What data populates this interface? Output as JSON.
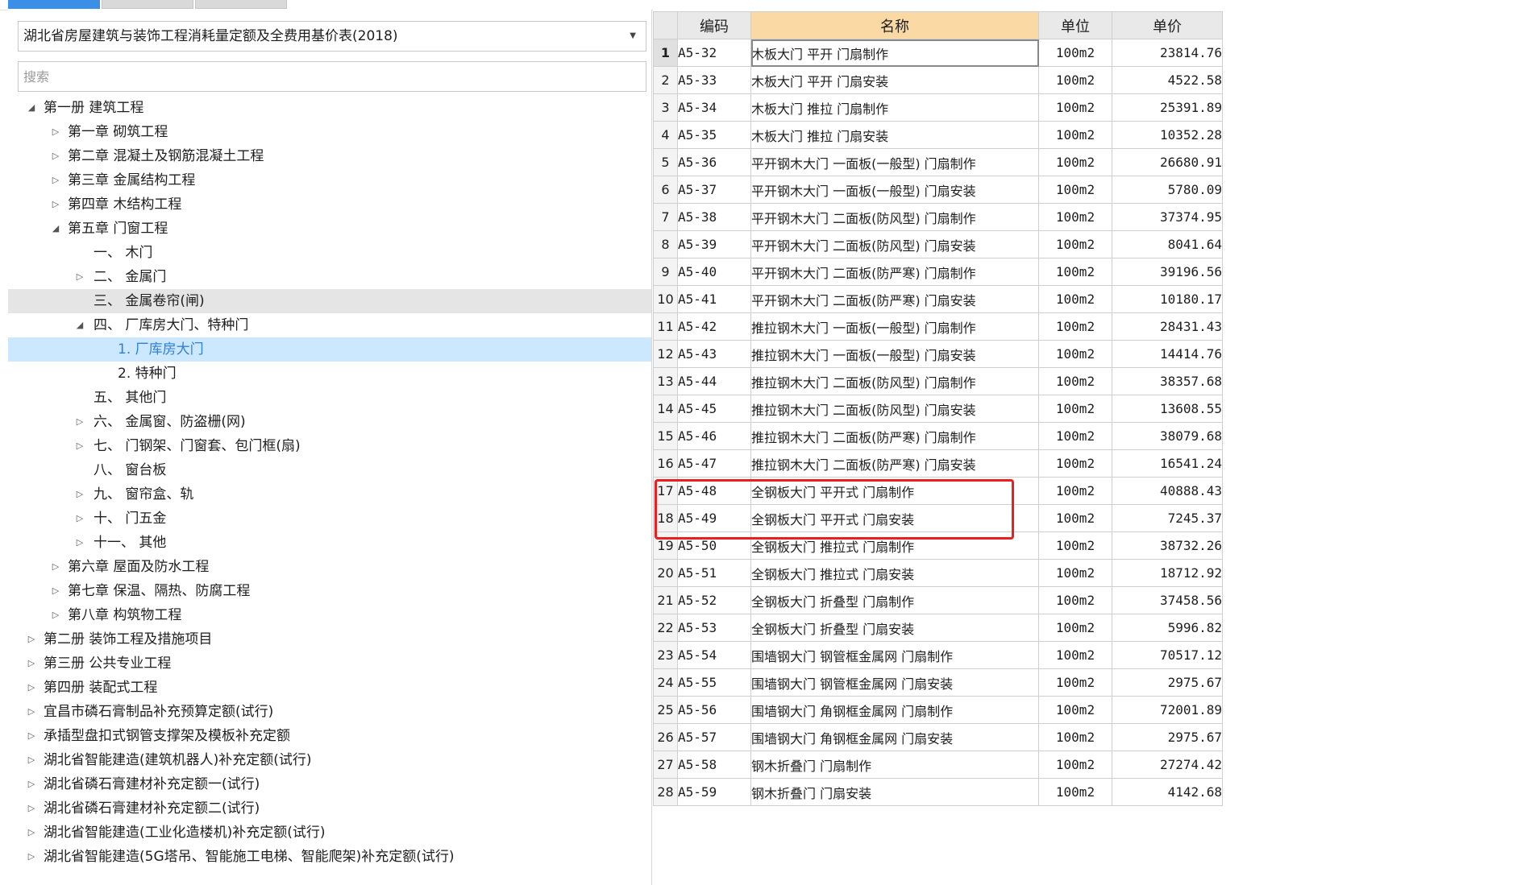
{
  "library": {
    "selected": "湖北省房屋建筑与装饰工程消耗量定额及全费用基价表(2018)"
  },
  "search": {
    "placeholder": "搜索"
  },
  "tree": [
    {
      "label": "第一册 建筑工程",
      "expander": "expanded"
    },
    {
      "label": "第一章 砌筑工程",
      "expander": "collapsed"
    },
    {
      "label": "第二章 混凝土及钢筋混凝土工程",
      "expander": "collapsed"
    },
    {
      "label": "第三章 金属结构工程",
      "expander": "collapsed"
    },
    {
      "label": "第四章 木结构工程",
      "expander": "collapsed"
    },
    {
      "label": "第五章 门窗工程",
      "expander": "expanded"
    },
    {
      "label": "一、 木门",
      "expander": "none"
    },
    {
      "label": "二、 金属门",
      "expander": "collapsed"
    },
    {
      "label": "三、 金属卷帘(闸)",
      "expander": "none",
      "state": "highlight"
    },
    {
      "label": "四、 厂库房大门、特种门",
      "expander": "expanded"
    },
    {
      "label": "1. 厂库房大门",
      "expander": "none",
      "state": "selected"
    },
    {
      "label": "2. 特种门",
      "expander": "none"
    },
    {
      "label": "五、 其他门",
      "expander": "none"
    },
    {
      "label": "六、 金属窗、防盗栅(网)",
      "expander": "collapsed"
    },
    {
      "label": "七、 门钢架、门窗套、包门框(扇)",
      "expander": "collapsed"
    },
    {
      "label": "八、 窗台板",
      "expander": "none"
    },
    {
      "label": "九、 窗帘盒、轨",
      "expander": "collapsed"
    },
    {
      "label": "十、 门五金",
      "expander": "collapsed"
    },
    {
      "label": "十一、 其他",
      "expander": "collapsed"
    },
    {
      "label": "第六章 屋面及防水工程",
      "expander": "collapsed"
    },
    {
      "label": "第七章 保温、隔热、防腐工程",
      "expander": "collapsed"
    },
    {
      "label": "第八章 构筑物工程",
      "expander": "collapsed"
    },
    {
      "label": "第二册 装饰工程及措施项目",
      "expander": "collapsed"
    },
    {
      "label": "第三册 公共专业工程",
      "expander": "collapsed"
    },
    {
      "label": "第四册 装配式工程",
      "expander": "collapsed"
    },
    {
      "label": "宜昌市磷石膏制品补充预算定额(试行)",
      "expander": "collapsed"
    },
    {
      "label": "承插型盘扣式钢管支撑架及模板补充定额",
      "expander": "collapsed"
    },
    {
      "label": "湖北省智能建造(建筑机器人)补充定额(试行)",
      "expander": "collapsed"
    },
    {
      "label": "湖北省磷石膏建材补充定额一(试行)",
      "expander": "collapsed"
    },
    {
      "label": "湖北省磷石膏建材补充定额二(试行)",
      "expander": "collapsed"
    },
    {
      "label": "湖北省智能建造(工业化造楼机)补充定额(试行)",
      "expander": "collapsed"
    },
    {
      "label": "湖北省智能建造(5G塔吊、智能施工电梯、智能爬架)补充定额(试行)",
      "expander": "collapsed"
    }
  ],
  "table": {
    "headers": {
      "code": "编码",
      "name": "名称",
      "unit": "单位",
      "price": "单价"
    },
    "rows": [
      {
        "no": "1",
        "code": "A5-32",
        "name": "木板大门 平开 门扇制作",
        "unit": "100m2",
        "price": "23814.76"
      },
      {
        "no": "2",
        "code": "A5-33",
        "name": "木板大门 平开 门扇安装",
        "unit": "100m2",
        "price": "4522.58"
      },
      {
        "no": "3",
        "code": "A5-34",
        "name": "木板大门 推拉 门扇制作",
        "unit": "100m2",
        "price": "25391.89"
      },
      {
        "no": "4",
        "code": "A5-35",
        "name": "木板大门 推拉 门扇安装",
        "unit": "100m2",
        "price": "10352.28"
      },
      {
        "no": "5",
        "code": "A5-36",
        "name": "平开钢木大门 一面板(一般型) 门扇制作",
        "unit": "100m2",
        "price": "26680.91"
      },
      {
        "no": "6",
        "code": "A5-37",
        "name": "平开钢木大门 一面板(一般型) 门扇安装",
        "unit": "100m2",
        "price": "5780.09"
      },
      {
        "no": "7",
        "code": "A5-38",
        "name": "平开钢木大门 二面板(防风型) 门扇制作",
        "unit": "100m2",
        "price": "37374.95"
      },
      {
        "no": "8",
        "code": "A5-39",
        "name": "平开钢木大门 二面板(防风型) 门扇安装",
        "unit": "100m2",
        "price": "8041.64"
      },
      {
        "no": "9",
        "code": "A5-40",
        "name": "平开钢木大门 二面板(防严寒) 门扇制作",
        "unit": "100m2",
        "price": "39196.56"
      },
      {
        "no": "10",
        "code": "A5-41",
        "name": "平开钢木大门 二面板(防严寒) 门扇安装",
        "unit": "100m2",
        "price": "10180.17"
      },
      {
        "no": "11",
        "code": "A5-42",
        "name": "推拉钢木大门 一面板(一般型) 门扇制作",
        "unit": "100m2",
        "price": "28431.43"
      },
      {
        "no": "12",
        "code": "A5-43",
        "name": "推拉钢木大门 一面板(一般型) 门扇安装",
        "unit": "100m2",
        "price": "14414.76"
      },
      {
        "no": "13",
        "code": "A5-44",
        "name": "推拉钢木大门 二面板(防风型) 门扇制作",
        "unit": "100m2",
        "price": "38357.68"
      },
      {
        "no": "14",
        "code": "A5-45",
        "name": "推拉钢木大门 二面板(防风型) 门扇安装",
        "unit": "100m2",
        "price": "13608.55"
      },
      {
        "no": "15",
        "code": "A5-46",
        "name": "推拉钢木大门 二面板(防严寒) 门扇制作",
        "unit": "100m2",
        "price": "38079.68"
      },
      {
        "no": "16",
        "code": "A5-47",
        "name": "推拉钢木大门 二面板(防严寒) 门扇安装",
        "unit": "100m2",
        "price": "16541.24"
      },
      {
        "no": "17",
        "code": "A5-48",
        "name": "全钢板大门 平开式 门扇制作",
        "unit": "100m2",
        "price": "40888.43"
      },
      {
        "no": "18",
        "code": "A5-49",
        "name": "全钢板大门 平开式 门扇安装",
        "unit": "100m2",
        "price": "7245.37"
      },
      {
        "no": "19",
        "code": "A5-50",
        "name": "全钢板大门 推拉式 门扇制作",
        "unit": "100m2",
        "price": "38732.26"
      },
      {
        "no": "20",
        "code": "A5-51",
        "name": "全钢板大门 推拉式 门扇安装",
        "unit": "100m2",
        "price": "18712.92"
      },
      {
        "no": "21",
        "code": "A5-52",
        "name": "全钢板大门 折叠型 门扇制作",
        "unit": "100m2",
        "price": "37458.56"
      },
      {
        "no": "22",
        "code": "A5-53",
        "name": "全钢板大门 折叠型 门扇安装",
        "unit": "100m2",
        "price": "5996.82"
      },
      {
        "no": "23",
        "code": "A5-54",
        "name": "围墙钢大门 钢管框金属网 门扇制作",
        "unit": "100m2",
        "price": "70517.12"
      },
      {
        "no": "24",
        "code": "A5-55",
        "name": "围墙钢大门 钢管框金属网 门扇安装",
        "unit": "100m2",
        "price": "2975.67"
      },
      {
        "no": "25",
        "code": "A5-56",
        "name": "围墙钢大门 角钢框金属网 门扇制作",
        "unit": "100m2",
        "price": "72001.89"
      },
      {
        "no": "26",
        "code": "A5-57",
        "name": "围墙钢大门 角钢框金属网 门扇安装",
        "unit": "100m2",
        "price": "2975.67"
      },
      {
        "no": "27",
        "code": "A5-58",
        "name": "钢木折叠门 门扇制作",
        "unit": "100m2",
        "price": "27274.42"
      },
      {
        "no": "28",
        "code": "A5-59",
        "name": "钢木折叠门 门扇安装",
        "unit": "100m2",
        "price": "4142.68"
      }
    ]
  },
  "colors": {
    "selected_bg": "#cce8ff",
    "selected_text": "#2f7fd6",
    "highlight_bg": "#e5e5e5",
    "name_header_bg": "#fbd9a4",
    "annotation": "#e8201f",
    "tab_active": "#3b8fe6"
  }
}
